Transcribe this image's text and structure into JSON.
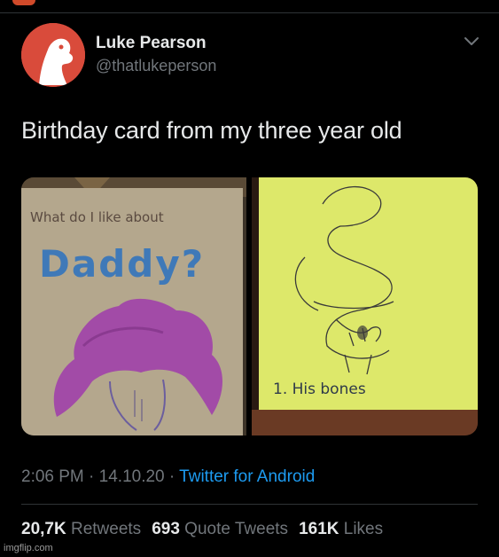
{
  "author": {
    "name": "Luke Pearson",
    "handle": "@thatlukeperson",
    "avatar_icon": "cartoon-face-avatar-icon"
  },
  "tweet": {
    "text": "Birthday card from my three year old"
  },
  "media": {
    "left_card": {
      "line1": "What do I like about",
      "line2": "Daddy?"
    },
    "right_card": {
      "caption": "1. His bones"
    }
  },
  "meta": {
    "time": "2:06 PM",
    "separator": "·",
    "date": "14.10.20",
    "source": "Twitter for Android"
  },
  "stats": {
    "retweets_count": "20,7K",
    "retweets_label": "Retweets",
    "quotes_count": "693",
    "quotes_label": "Quote Tweets",
    "likes_count": "161K",
    "likes_label": "Likes"
  },
  "watermark": "imgflip.com",
  "colors": {
    "background": "#000000",
    "text": "#e7e9ea",
    "secondary": "#71767b",
    "link": "#1d9bf0",
    "divider": "#2f3336",
    "avatar": "#d94b3b",
    "cardboard": "#b9ab92",
    "paper_yellow": "#dde86a",
    "crayon_blue": "#3f79b8",
    "crayon_purple": "#a24ba7"
  }
}
